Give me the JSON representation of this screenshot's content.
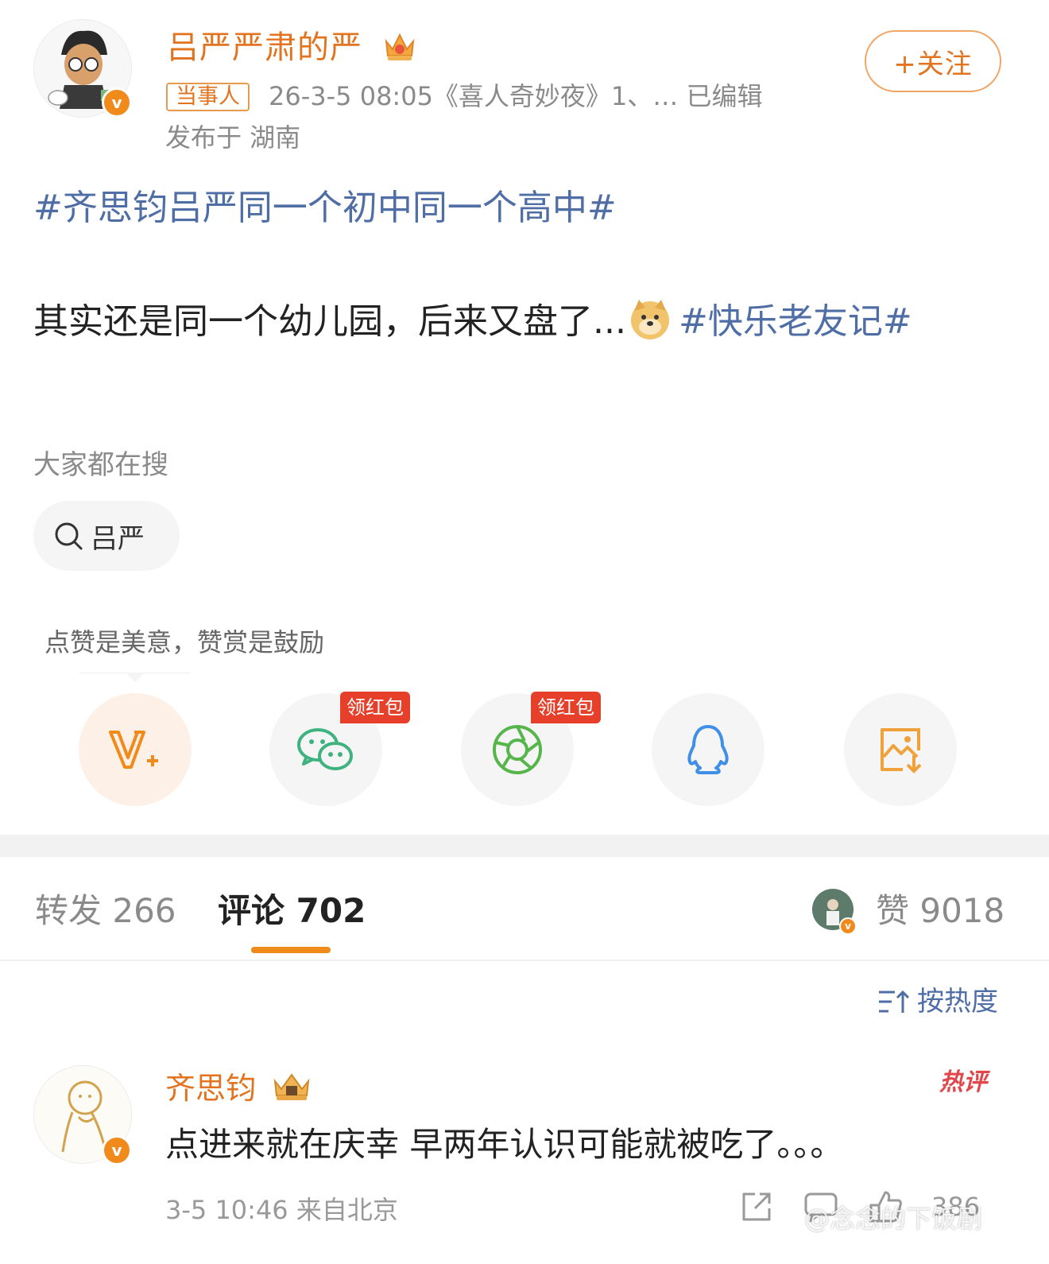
{
  "post": {
    "author": {
      "name": "吕严严肃的严",
      "badge": "当事人"
    },
    "meta": "26-3-5 08:05《喜人奇妙夜》1、… 已编辑",
    "location": "发布于 湖南",
    "follow_label": "+关注",
    "topic": "#齐思钧吕严同一个初中同一个高中#",
    "text": "其实还是同一个幼儿园，后来又盘了...",
    "text_tag": "#快乐老友记#"
  },
  "search": {
    "title": "大家都在搜",
    "chip": "吕严"
  },
  "reward": {
    "tip": "点赞是美意，赞赏是鼓励"
  },
  "share": {
    "items": [
      {
        "icon": "v-plus-icon"
      },
      {
        "icon": "wechat-icon",
        "tag": "领红包"
      },
      {
        "icon": "moments-icon",
        "tag": "领红包"
      },
      {
        "icon": "qq-icon"
      },
      {
        "icon": "save-image-icon"
      }
    ]
  },
  "tabs": {
    "repost": "转发 266",
    "comment": "评论 702",
    "like": "赞 9018"
  },
  "sort_label": "按热度",
  "comment": {
    "name": "齐思钧",
    "hot_tag": "热评",
    "text": "点进来就在庆幸 早两年认识可能就被吃了。。。",
    "meta": "3-5 10:46 来自北京",
    "like_count": "386"
  },
  "watermark": "@念念的下饭剧",
  "colors": {
    "accent": "#e2731f",
    "topic": "#4f6ea6",
    "hot": "#e0464a"
  }
}
